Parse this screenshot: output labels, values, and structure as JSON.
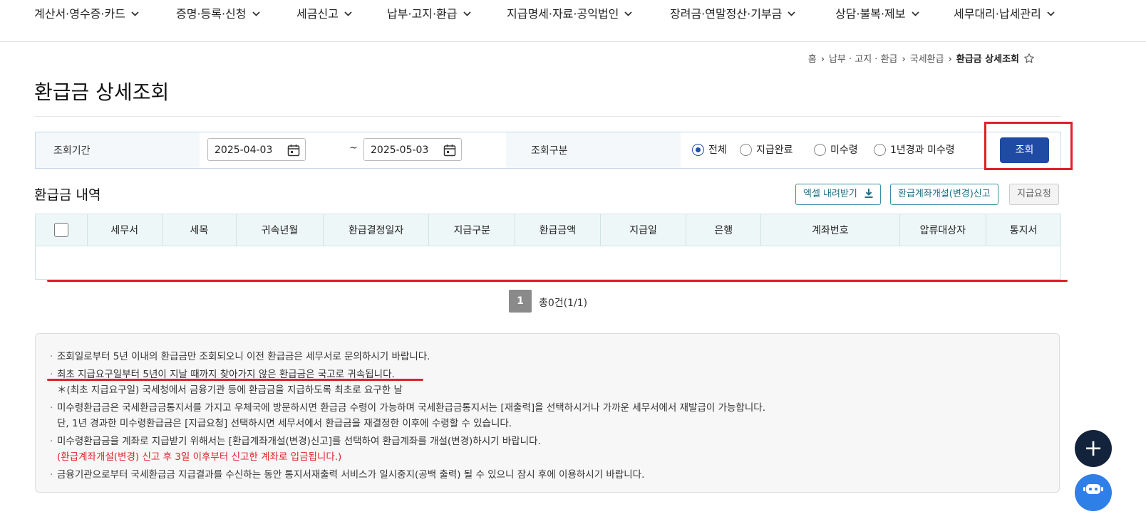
{
  "nav": {
    "items": [
      "계산서·영수증·카드",
      "증명·등록·신청",
      "세금신고",
      "납부·고지·환급",
      "지급명세·자료·공익법인",
      "장려금·연말정산·기부금",
      "상담·불복·제보",
      "세무대리·납세관리"
    ]
  },
  "breadcrumb": {
    "items": [
      "홈",
      "납부 · 고지 · 환급",
      "국세환급"
    ],
    "current": "환급금 상세조회"
  },
  "page": {
    "title": "환급금 상세조회"
  },
  "search": {
    "period_label": "조회기간",
    "start_date": "2025-04-03",
    "tilde": "~",
    "end_date": "2025-05-03",
    "type_label": "조회구분",
    "options": [
      "전체",
      "지급완료",
      "미수령",
      "1년경과 미수령"
    ],
    "selected": "전체",
    "button_label": "조회"
  },
  "list": {
    "title": "환급금 내역",
    "excel_label": "엑셀 내려받기",
    "account_label": "환급계좌개설(변경)신고",
    "payment_request_label": "지급요청",
    "columns": [
      "세무서",
      "세목",
      "귀속년월",
      "환급결정일자",
      "지급구분",
      "환급금액",
      "지급일",
      "은행",
      "계좌번호",
      "압류대상자",
      "통지서"
    ],
    "rows": []
  },
  "pagination": {
    "current_page": "1",
    "summary": "총0건(1/1)"
  },
  "notice": {
    "line1": "조회일로부터 5년 이내의 환급금만 조회되오니 이전 환급금은 세무서로 문의하시기 바랍니다.",
    "line2": "최초 지급요구일부터 5년이 지날 때까지 찾아가지 않은 환급금은 국고로 귀속됩니다.",
    "line2_sub": "＊(최초 지급요구일) 국세청에서 금융기관 등에 환급금을 지급하도록 최초로 요구한 날",
    "line3": "미수령환급금은 국세환급금통지서를 가지고 우체국에 방문하시면 환급금 수령이 가능하며 국세환급금통지서는 [재출력]을 선택하시거나 가까운 세무서에서 재발급이 가능합니다.",
    "line3_sub": "단, 1년 경과한 미수령환급금은 [지급요청] 선택하시면 세무서에서 환급금을 재결정한 이후에 수령할 수 있습니다.",
    "line4": "미수령환급금을 계좌로 지급받기 위해서는 [환급계좌개설(변경)신고]를 선택하여 환급계좌를 개설(변경)하시기 바랍니다.",
    "line4_red": "(환급계좌개설(변경) 신고 후 3일 이후부터 신고한 계좌로 입금됩니다.)",
    "line5": "금융기관으로부터 국세환급금 지급결과를 수신하는 동안 통지서재출력 서비스가 일시중지(공백 출력) 될 수 있으니 잠시 후에 이용하시기 바랍니다."
  },
  "floating": {
    "plus": "+"
  },
  "colors": {
    "primary": "#1f4ba3",
    "highlight": "#e0202a",
    "table_header": "#eef7f7"
  }
}
